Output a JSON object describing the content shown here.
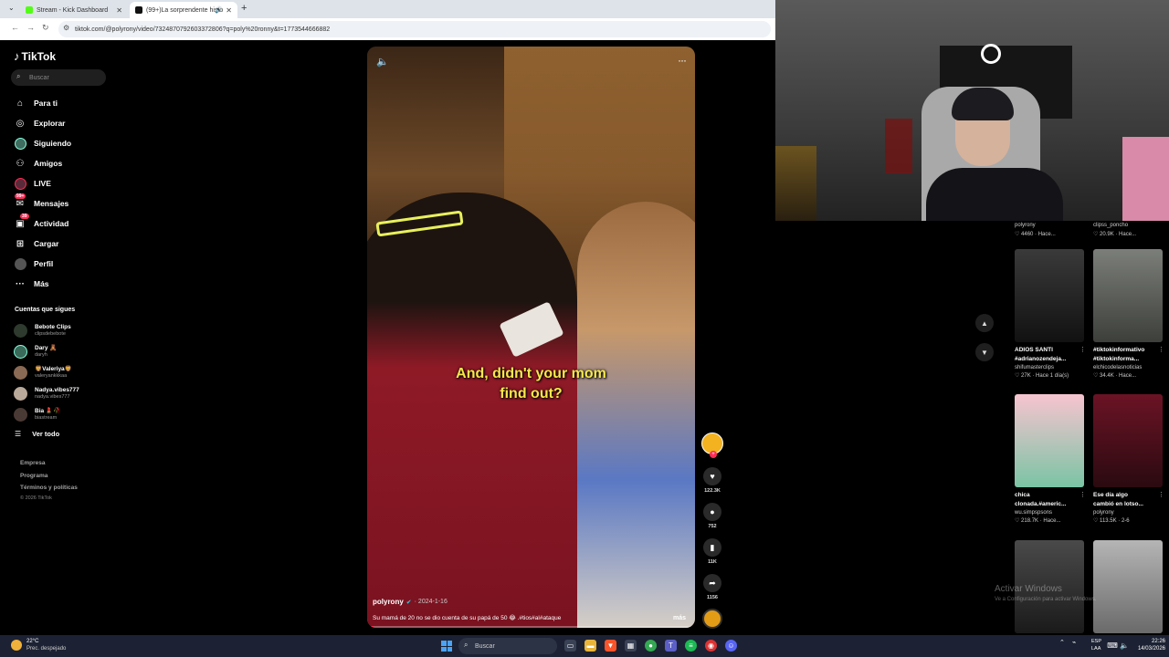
{
  "browser": {
    "tabs": [
      {
        "title": "Stream - Kick Dashboard",
        "favicon_color": "#53fc18"
      },
      {
        "title": "(99+)La sorprendente histo",
        "favicon_color": "#111111"
      }
    ],
    "url": "tiktok.com/@polyrony/video/7324870792603372806?q=poly%20ronny&t=1773544666882"
  },
  "sidebar": {
    "logo": "TikTok",
    "search_placeholder": "Buscar",
    "nav": [
      {
        "label": "Para ti",
        "icon": "home-icon",
        "glyph": "⌂"
      },
      {
        "label": "Explorar",
        "icon": "compass-icon",
        "glyph": "◎"
      },
      {
        "label": "Siguiendo",
        "icon": "following-avatar-icon",
        "glyph": ""
      },
      {
        "label": "Amigos",
        "icon": "friends-icon",
        "glyph": "👥"
      },
      {
        "label": "LIVE",
        "icon": "live-icon",
        "glyph": ""
      },
      {
        "label": "Mensajes",
        "icon": "messages-icon",
        "glyph": "",
        "badge": "99+"
      },
      {
        "label": "Actividad",
        "icon": "activity-icon",
        "glyph": "",
        "badge": "39"
      },
      {
        "label": "Cargar",
        "icon": "upload-icon",
        "glyph": "⊞"
      },
      {
        "label": "Perfil",
        "icon": "profile-avatar-icon",
        "glyph": ""
      },
      {
        "label": "Más",
        "icon": "more-dots-icon",
        "glyph": "···"
      }
    ],
    "following_title": "Cuentas que sigues",
    "following": [
      {
        "name": "Bebote Clips",
        "handle": "clipsdebebote"
      },
      {
        "name": "Dary 🧸",
        "handle": "daryh"
      },
      {
        "name": "🦁Valeriya🦁",
        "handle": "valeryankkkaa"
      },
      {
        "name": "Nadya.vibes777",
        "handle": "nadya.vibes777"
      },
      {
        "name": "Bia 💄🥀",
        "handle": "biastream"
      }
    ],
    "see_all": "Ver todo",
    "footer": [
      "Empresa",
      "Programa",
      "Términos y políticas"
    ],
    "copyright": "© 2026 TikTok"
  },
  "video": {
    "caption_line1": "And, didn't your mom",
    "caption_line2": "find out?",
    "author": "polyrony",
    "date": "· 2024-1-16",
    "description": "Su mamá de 20 no se dio cuenta de su papá de 50 😂 .#tios#al#ataque",
    "more": "más",
    "progress": 0.02
  },
  "actions": {
    "likes": "122.3K",
    "comments": "752",
    "saves": "11K",
    "shares": "1156"
  },
  "grid": {
    "top_items": [
      {
        "author": "polyrony",
        "stats": "♡ 4460 · Hace..."
      },
      {
        "author": "clipss_poncho",
        "stats": "♡ 20.9K · Hace..."
      }
    ],
    "items": [
      {
        "title": "ADIOS SANTI",
        "title2": "#adrianozendeja...",
        "author": "shifumasterclips",
        "stats": "♡ 27K · Hace 1 día(s)",
        "thumb": "#2b2b2b"
      },
      {
        "title": "#tiktokinformativo",
        "title2": "#tiktokinforma...",
        "author": "elchicodelasnoticias",
        "stats": "♡ 34.4K · Hace...",
        "thumb": "#6b6f6a"
      },
      {
        "title": "chica",
        "title2": "clonada.#americ...",
        "author": "wu.simpspsons",
        "stats": "♡ 218.7K · Hace...",
        "thumb": "#f4b6c2"
      },
      {
        "title": "Ese día algo",
        "title2": "cambió en lotso...",
        "author": "polyrony",
        "stats": "♡ 113.5K · 2-6",
        "thumb": "#5a1020"
      },
      {
        "title": "",
        "title2": "",
        "author": "",
        "stats": "",
        "thumb": "#3a3a3a"
      },
      {
        "title": "",
        "title2": "",
        "author": "",
        "stats": "",
        "thumb": "#8a8a8a"
      }
    ]
  },
  "watermark": {
    "title": "Activar Windows",
    "subtitle": "Ve a Configuración para activar Windows."
  },
  "taskbar": {
    "weather_temp": "22°C",
    "weather_desc": "Prec. despejado",
    "search": "Buscar",
    "lang1": "ESP",
    "lang2": "LAA",
    "time": "22:26",
    "date": "14/03/2026"
  }
}
